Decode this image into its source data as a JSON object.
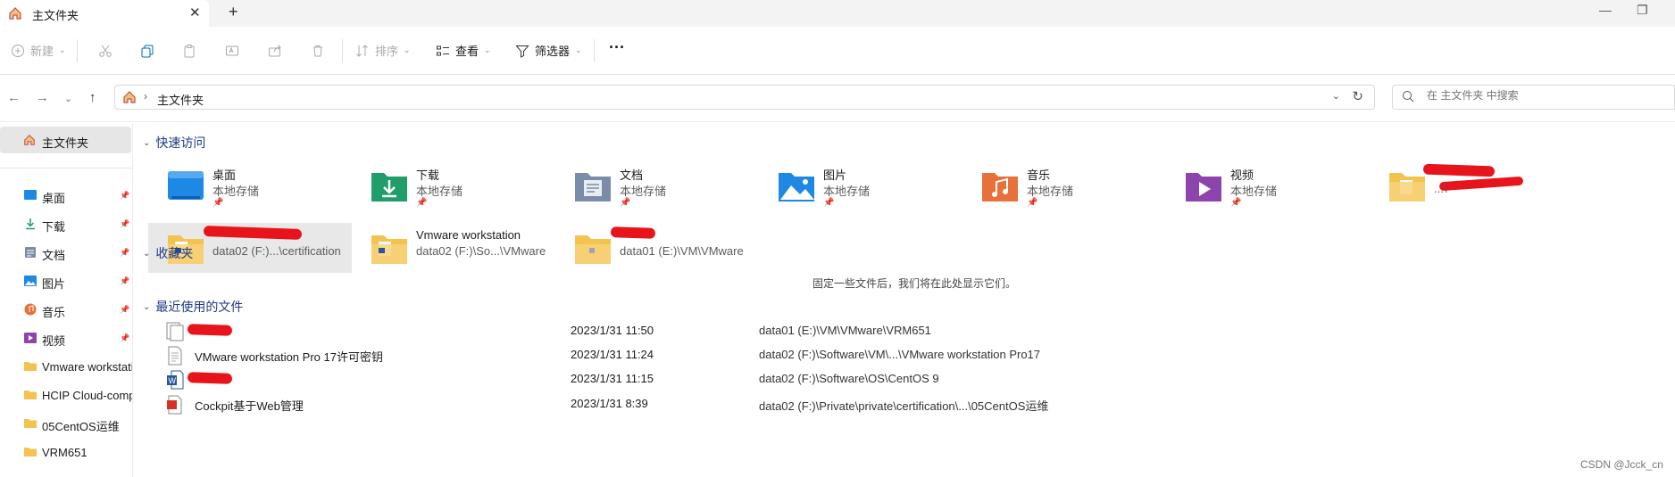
{
  "tab": {
    "title": "主文件夹",
    "close": "✕",
    "new": "+"
  },
  "window": {
    "minimize": "—",
    "maximize": "❐"
  },
  "toolbar": {
    "new_label": "新建",
    "sort_label": "排序",
    "view_label": "查看",
    "filter_label": "筛选器",
    "more_label": "···"
  },
  "address": {
    "crumb": "主文件夹"
  },
  "search": {
    "placeholder": "在 主文件夹 中搜索"
  },
  "sidebar": {
    "home_label": "主文件夹",
    "items": [
      {
        "label": "桌面",
        "icon": "desktop-icon",
        "pinned": true
      },
      {
        "label": "下载",
        "icon": "download-icon",
        "pinned": true
      },
      {
        "label": "文档",
        "icon": "document-icon",
        "pinned": true
      },
      {
        "label": "图片",
        "icon": "picture-icon",
        "pinned": true
      },
      {
        "label": "音乐",
        "icon": "music-icon",
        "pinned": true
      },
      {
        "label": "视频",
        "icon": "video-icon",
        "pinned": true
      },
      {
        "label": "Vmware workstation",
        "icon": "folder-icon",
        "pinned": false
      },
      {
        "label": "HCIP Cloud-computing",
        "icon": "folder-icon",
        "pinned": false
      },
      {
        "label": "05CentOS运维",
        "icon": "folder-icon",
        "pinned": false
      },
      {
        "label": "VRM651",
        "icon": "folder-icon",
        "pinned": false
      }
    ]
  },
  "sections": {
    "quick_access": "快速访问",
    "favorites": "收藏夹",
    "recent": "最近使用的文件",
    "favorites_empty": "固定一些文件后，我们将在此处显示它们。"
  },
  "quick_access": [
    {
      "name": "桌面",
      "sub": "本地存储"
    },
    {
      "name": "下载",
      "sub": "本地存储"
    },
    {
      "name": "文档",
      "sub": "本地存储"
    },
    {
      "name": "图片",
      "sub": "本地存储"
    },
    {
      "name": "音乐",
      "sub": "本地存储"
    },
    {
      "name": "视频",
      "sub": "本地存储"
    },
    {
      "name": "",
      "sub": "...\\"
    },
    {
      "name": "",
      "sub": "data02 (F:)...\\certification"
    },
    {
      "name": "Vmware workstation",
      "sub": "data02 (F:)\\So...\\VMware"
    },
    {
      "name": "",
      "sub": "data01 (E:)\\VM\\VMware"
    }
  ],
  "recent": [
    {
      "name": "",
      "date": "2023/1/31 11:50",
      "path": "data01 (E:)\\VM\\VMware\\VRM651"
    },
    {
      "name": "VMware workstation Pro 17许可密钥",
      "date": "2023/1/31 11:24",
      "path": "data02 (F:)\\Software\\VM\\...\\VMware workstation Pro17"
    },
    {
      "name": "",
      "date": "2023/1/31 11:15",
      "path": "data02 (F:)\\Software\\OS\\CentOS 9"
    },
    {
      "name": "Cockpit基于Web管理",
      "date": "2023/1/31 8:39",
      "path": "data02 (F:)\\Private\\private\\certification\\...\\05CentOS运维"
    }
  ],
  "watermark": "CSDN @Jcck_cn",
  "colors": {
    "accent": "#0067c0",
    "section": "#1e3a8a",
    "selected": "#e8e8e8",
    "redaction": "#e8141c"
  }
}
